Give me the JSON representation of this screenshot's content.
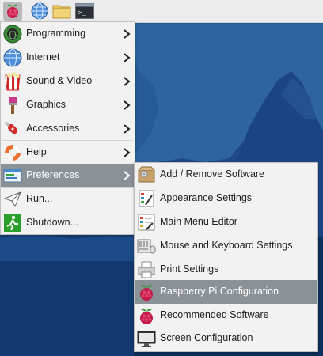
{
  "colors": {
    "menu_bg": "#f2f2f2",
    "highlight": "#8a9197",
    "text": "#1e1e1e",
    "taskbar_bg": "#ececec",
    "desktop": "#1c4480"
  },
  "taskbar": {
    "items": [
      {
        "name": "raspberry-menu-button",
        "icon": "raspberry-icon"
      },
      {
        "name": "web-browser-launcher",
        "icon": "globe-icon"
      },
      {
        "name": "file-manager-launcher",
        "icon": "folder-icon"
      },
      {
        "name": "terminal-launcher",
        "icon": "terminal-icon",
        "label": ">_"
      }
    ]
  },
  "main_menu": {
    "items": [
      {
        "label": "Programming",
        "icon": "programming-icon",
        "has_submenu": true
      },
      {
        "label": "Internet",
        "icon": "globe-icon",
        "has_submenu": true
      },
      {
        "label": "Sound & Video",
        "icon": "sound-video-icon",
        "has_submenu": true
      },
      {
        "label": "Graphics",
        "icon": "paintbrush-icon",
        "has_submenu": true
      },
      {
        "label": "Accessories",
        "icon": "swiss-knife-icon",
        "has_submenu": true
      },
      {
        "label": "Help",
        "icon": "lifebuoy-icon",
        "has_submenu": true
      },
      {
        "label": "Preferences",
        "icon": "preferences-icon",
        "has_submenu": true,
        "highlighted": true
      },
      {
        "label": "Run...",
        "icon": "paper-plane-icon",
        "has_submenu": false
      },
      {
        "label": "Shutdown...",
        "icon": "exit-icon",
        "has_submenu": false
      }
    ]
  },
  "preferences_submenu": {
    "items": [
      {
        "label": "Add / Remove Software",
        "icon": "package-icon"
      },
      {
        "label": "Appearance Settings",
        "icon": "appearance-icon"
      },
      {
        "label": "Main Menu Editor",
        "icon": "menu-editor-icon"
      },
      {
        "label": "Mouse and Keyboard Settings",
        "icon": "keyboard-mouse-icon"
      },
      {
        "label": "Print Settings",
        "icon": "printer-icon"
      },
      {
        "label": "Raspberry Pi Configuration",
        "icon": "raspberry-icon",
        "highlighted": true
      },
      {
        "label": "Recommended Software",
        "icon": "raspberry-icon"
      },
      {
        "label": "Screen Configuration",
        "icon": "monitor-icon"
      }
    ]
  }
}
